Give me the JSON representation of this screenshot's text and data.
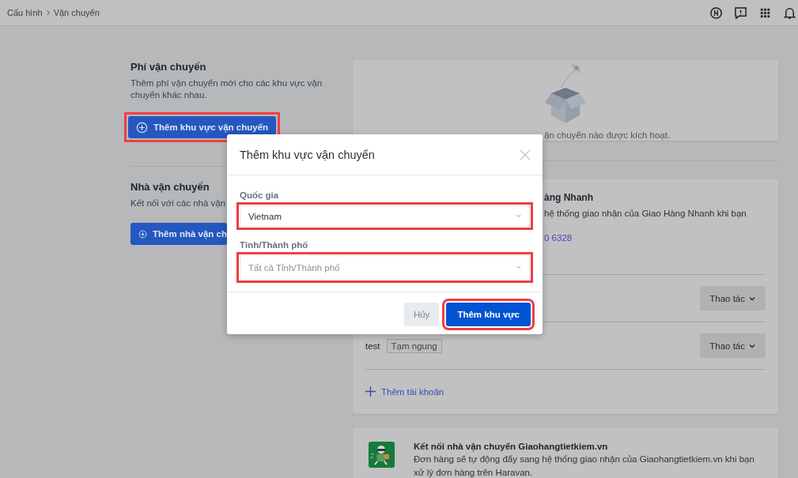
{
  "breadcrumb": [
    "Cấu hình",
    "Vận chuyển"
  ],
  "shipping_fees": {
    "title": "Phí vận chuyển",
    "description": "Thêm phí vận chuyển mới cho các khu vực vận chuyển khác nhau.",
    "button": {
      "label": "Thêm khu vực vận chuyển",
      "highlighted": true
    }
  },
  "carriers": {
    "title": "Nhà vận chuyển",
    "description": "Kết nối với các nhà vận",
    "button": {
      "label": "Thêm nhà vận ch",
      "highlighted": false
    }
  },
  "empty_state": {
    "message": "ận chuyển nào được kích hoạt."
  },
  "ghn_card": {
    "title": "àng Nhanh",
    "description": "hệ thống giao nhận của Giao Hàng Nhanh khi bạn",
    "phone": "0 6328",
    "accounts": [
      {
        "action": "Thao tác"
      },
      {
        "name": "test",
        "status": "Tạm ngung",
        "action": "Thao tác"
      }
    ],
    "add_account": "Thêm tài khoản"
  },
  "ghtk_card": {
    "title": "Kết nối nhà vận chuyển Giaohangtietkiem.vn",
    "description": "Đơn hàng sẽ tự động đẩy sang hệ thống giao nhận của Giaohangtietkiem.vn khi bạn xử lý đơn hàng trên Haravan."
  },
  "modal": {
    "title": "Thêm khu vực vận chuyển",
    "fields": [
      {
        "label": "Quốc gia",
        "value": "Vietnam",
        "highlighted": true
      },
      {
        "label": "Tỉnh/Thành phố",
        "placeholder": "Tất cả Tỉnh/Thành phố",
        "highlighted": true
      }
    ],
    "buttons": [
      {
        "label": "Hủy",
        "kind": "secondary",
        "highlighted": false
      },
      {
        "label": "Thêm khu vực",
        "kind": "primary",
        "highlighted": true
      }
    ]
  }
}
